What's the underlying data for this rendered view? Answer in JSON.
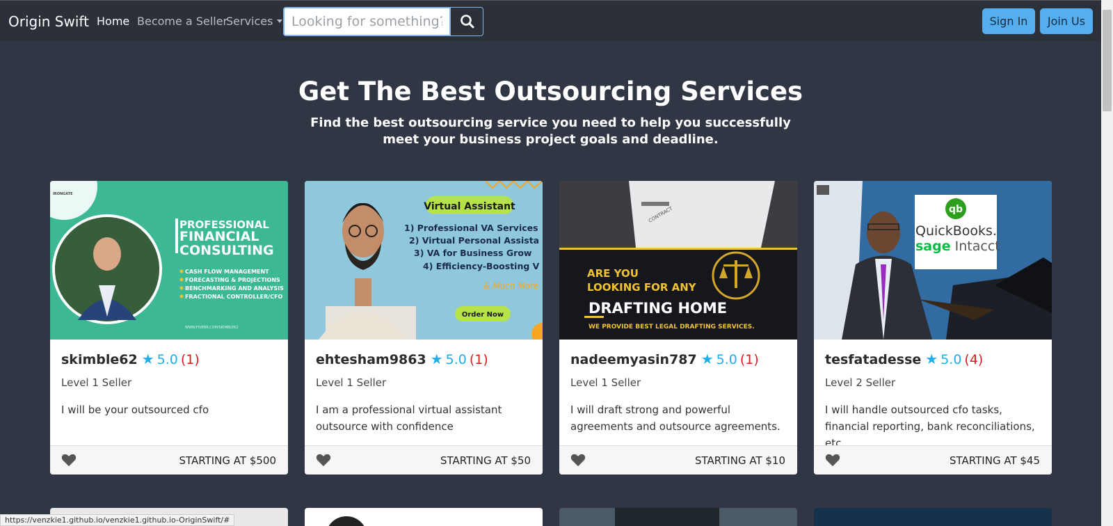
{
  "navbar": {
    "brand": "Origin Swift",
    "links": {
      "home": "Home",
      "seller": "Become a Seller",
      "services": "Services"
    },
    "search_placeholder": "Looking for something?",
    "sign_in": "Sign In",
    "join": "Join Us"
  },
  "hero": {
    "title": "Get The Best Outsourcing Services",
    "subtitle": "Find the best outsourcing service you need to help you successfully meet your business project goals and deadline."
  },
  "cards": [
    {
      "seller": "skimble62",
      "rating": "5.0",
      "count": "(1)",
      "level": "Level 1 Seller",
      "description": "I will be your outsourced cfo",
      "price": "STARTING AT $500",
      "image": {
        "heading": [
          "PROFESSIONAL",
          "FINANCIAL",
          "CONSULTING"
        ],
        "bullets": [
          "CASH FLOW MANAGEMENT",
          "FORECASTING & PROJECTIONS",
          "BENCHMARKING AND ANALYSIS",
          "FRACTIONAL CONTROLLER/CFO"
        ],
        "footer": "WWW.FIVERR.COM/SKIMBLE62",
        "logo": "IRONGATE",
        "bg": "#3fbf9b"
      }
    },
    {
      "seller": "ehtesham9863",
      "rating": "5.0",
      "count": "(1)",
      "level": "Level 1 Seller",
      "description": "I am a professional virtual assistant outsource with confidence",
      "price": "STARTING AT $50",
      "image": {
        "badge": "Virtual Assistant",
        "lines": [
          "1) Professional VA Services",
          "2) Virtual Personal Assista",
          "3) VA for Business Grow",
          "4) Efficiency-Boosting V"
        ],
        "more": "& Much More",
        "cta": "Order Now",
        "bg": "#8fc8dc"
      }
    },
    {
      "seller": "nadeemyasin787",
      "rating": "5.0",
      "count": "(1)",
      "level": "Level 1 Seller",
      "description": "I will draft strong and powerful agreements and outsource agreements.",
      "price": "STARTING AT $10",
      "image": {
        "line1": "ARE YOU",
        "line2": "LOOKING FOR ANY",
        "line3": "DRAFTING HOME",
        "line4": "WE PROVIDE BEST LEGAL DRAFTING  SERVICES.",
        "paper": "CONTRACT",
        "bg": "#16171c"
      }
    },
    {
      "seller": "tesfatadesse",
      "rating": "5.0",
      "count": "(4)",
      "level": "Level 2 Seller",
      "description": "I will handle outsourced cfo tasks, financial reporting, bank reconciliations, etc.",
      "price": "STARTING AT $45",
      "image": {
        "logo_mark": "qb",
        "brand1": "QuickBooks.",
        "brand2a": "sage",
        "brand2b": " Intacct",
        "bg": "#3a7bb8"
      }
    }
  ],
  "status_url": "https://venzkie1.github.io/venzkie1.github.io-OriginSwift/#"
}
